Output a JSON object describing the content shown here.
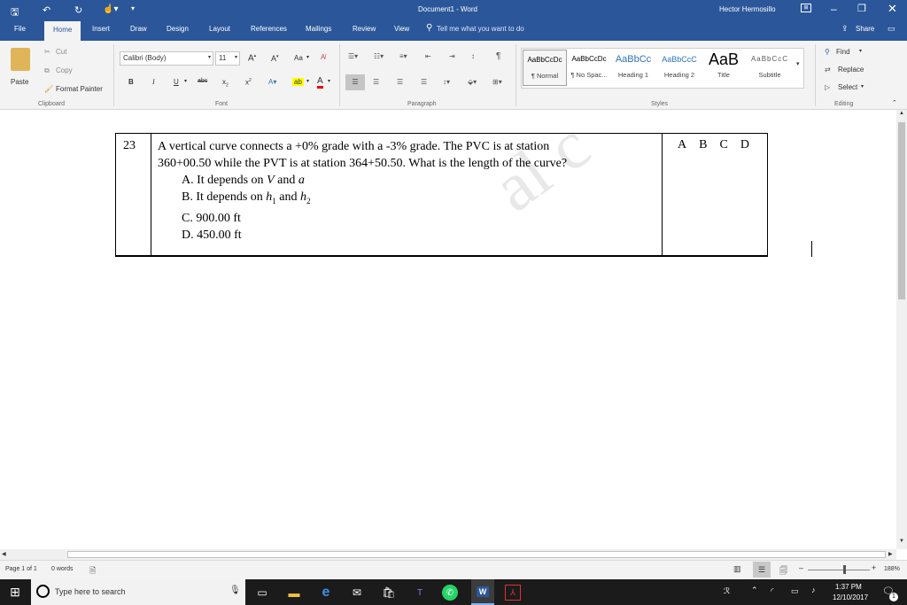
{
  "window": {
    "title": "Document1 - Word",
    "user": "Hector Hermosillo"
  },
  "tabs": [
    "File",
    "Home",
    "Insert",
    "Draw",
    "Design",
    "Layout",
    "References",
    "Mailings",
    "Review",
    "View"
  ],
  "tell_me": "Tell me what you want to do",
  "share": "Share",
  "clipboard": {
    "cut": "Cut",
    "copy": "Copy",
    "paste": "Paste",
    "format_painter": "Format Painter",
    "label": "Clipboard"
  },
  "font": {
    "name": "Calibri (Body)",
    "size": "11",
    "label": "Font",
    "change_case": "Aa",
    "bold": "B",
    "italic": "I",
    "underline": "U",
    "strike": "abc",
    "subscript": "x",
    "superscript": "x",
    "subscript_index": "2",
    "superscript_index": "2"
  },
  "paragraph": {
    "label": "Paragraph"
  },
  "styles": {
    "label": "Styles",
    "items": [
      {
        "preview": "AaBbCcDc",
        "name": "¶ Normal"
      },
      {
        "preview": "AaBbCcDc",
        "name": "¶ No Spac..."
      },
      {
        "preview": "AaBbCc",
        "name": "Heading 1"
      },
      {
        "preview": "AaBbCcC",
        "name": "Heading 2"
      },
      {
        "preview": "AaB",
        "name": "Title"
      },
      {
        "preview": "AaBbCcC",
        "name": "Subtitle"
      }
    ]
  },
  "editing": {
    "find": "Find",
    "replace": "Replace",
    "select": "Select",
    "label": "Editing"
  },
  "document": {
    "number": "23",
    "question_line1": "A vertical curve connects a +0% grade with a -3% grade.  The PVC is at station",
    "question_line2": "360+00.50 while the PVT is at station 364+50.50.  What is the length of the curve?",
    "options": [
      {
        "letter": "A.",
        "text": "It depends on ",
        "v1": "V",
        "mid": " and ",
        "v2": "a"
      },
      {
        "letter": "B.",
        "text": "It depends on ",
        "v1": "h",
        "s1": "1",
        "mid": " and ",
        "v2": "h",
        "s2": "2"
      },
      {
        "letter": "C.",
        "text": "900.00 ft"
      },
      {
        "letter": "D.",
        "text": "450.00 ft"
      }
    ],
    "answer_letters": [
      "A",
      "B",
      "C",
      "D"
    ],
    "watermark": "al c"
  },
  "status": {
    "page": "Page 1 of 1",
    "words": "0 words",
    "zoom": "188%"
  },
  "taskbar": {
    "search": "Type here to search",
    "time": "1:37 PM",
    "date": "12/10/2017",
    "notifications": "1"
  }
}
